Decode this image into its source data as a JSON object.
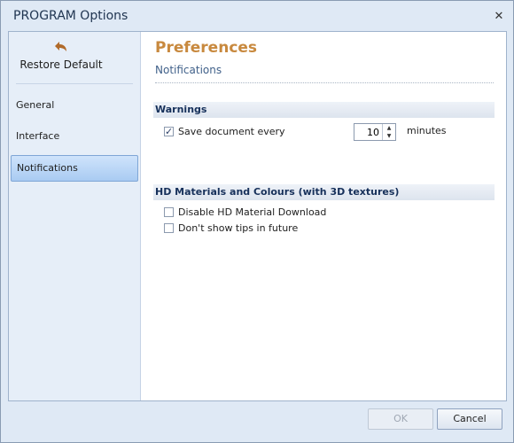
{
  "window": {
    "title": "PROGRAM Options"
  },
  "sidebar": {
    "restore_label": "Restore Default",
    "items": [
      {
        "label": "General",
        "active": false
      },
      {
        "label": "Interface",
        "active": false
      },
      {
        "label": "Notifications",
        "active": true
      }
    ]
  },
  "content": {
    "title": "Preferences",
    "subtitle": "Notifications",
    "warnings": {
      "heading": "Warnings",
      "save_label": "Save document every",
      "save_checked": true,
      "interval_value": "10",
      "unit": "minutes"
    },
    "hd": {
      "heading": "HD Materials and Colours (with 3D textures)",
      "disable_download_label": "Disable HD Material Download",
      "disable_download_checked": false,
      "no_tips_label": "Don't show tips in future",
      "no_tips_checked": false
    }
  },
  "buttons": {
    "ok_label": "OK",
    "cancel_label": "Cancel"
  },
  "colors": {
    "accent_title": "#c8893e",
    "section_text": "#16305a",
    "window_bg": "#dfe9f5"
  }
}
